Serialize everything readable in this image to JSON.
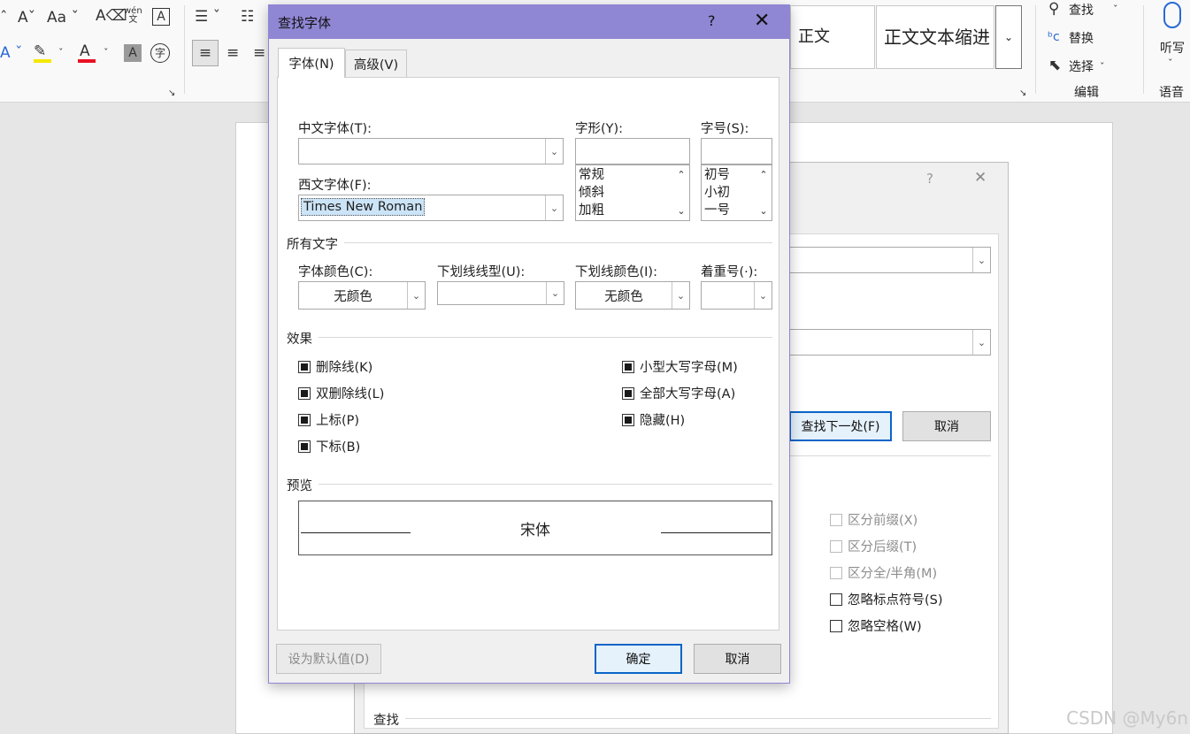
{
  "ribbon": {
    "styles": [
      "正文",
      "正文文本缩进"
    ],
    "editing": {
      "find_label": "查找",
      "replace_label": "替换",
      "select_label": "选择",
      "group_label": "编辑"
    },
    "voice": {
      "dictate_label": "听写",
      "group_label": "语音"
    },
    "font_aa_label": "Aa",
    "phonetic_label": "wén"
  },
  "bg_dialog": {
    "help": "?",
    "close": "✕",
    "find_next_label": "查找下一处(F)",
    "cancel_label": "取消",
    "options": [
      {
        "label": "区分前缀(X)",
        "enabled": false,
        "checked": false
      },
      {
        "label": "区分后缀(T)",
        "enabled": false,
        "checked": false
      },
      {
        "label": "区分全/半角(M)",
        "enabled": false,
        "checked": false
      },
      {
        "label": "忽略标点符号(S)",
        "enabled": true,
        "checked": false
      },
      {
        "label": "忽略空格(W)",
        "enabled": true,
        "checked": false
      }
    ],
    "find_section_label": "查找"
  },
  "font_dialog": {
    "title": "查找字体",
    "help": "?",
    "close": "✕",
    "tabs": [
      {
        "label": "字体(N)",
        "active": true
      },
      {
        "label": "高级(V)",
        "active": false
      }
    ],
    "chinese_font_label": "中文字体(T):",
    "chinese_font_value": "",
    "western_font_label": "西文字体(F):",
    "western_font_value": "Times New Roman",
    "style_label": "字形(Y):",
    "style_value": "",
    "styles": [
      "常规",
      "倾斜",
      "加粗"
    ],
    "size_label": "字号(S):",
    "size_value": "",
    "sizes": [
      "初号",
      "小初",
      "一号"
    ],
    "all_text_section": "所有文字",
    "font_color_label": "字体颜色(C):",
    "font_color_value": "无颜色",
    "underline_style_label": "下划线线型(U):",
    "underline_style_value": "",
    "underline_color_label": "下划线颜色(I):",
    "underline_color_value": "无颜色",
    "emphasis_label": "着重号(·):",
    "emphasis_value": "",
    "effects_section": "效果",
    "effects_left": [
      "删除线(K)",
      "双删除线(L)",
      "上标(P)",
      "下标(B)"
    ],
    "effects_right": [
      "小型大写字母(M)",
      "全部大写字母(A)",
      "隐藏(H)"
    ],
    "preview_section": "预览",
    "preview_text": "宋体",
    "set_default_label": "设为默认值(D)",
    "ok_label": "确定",
    "cancel_label": "取消"
  },
  "watermark": "CSDN @My6n",
  "colors": {
    "title_bar": "#8f86d4",
    "primary_border": "#0a64c8"
  }
}
